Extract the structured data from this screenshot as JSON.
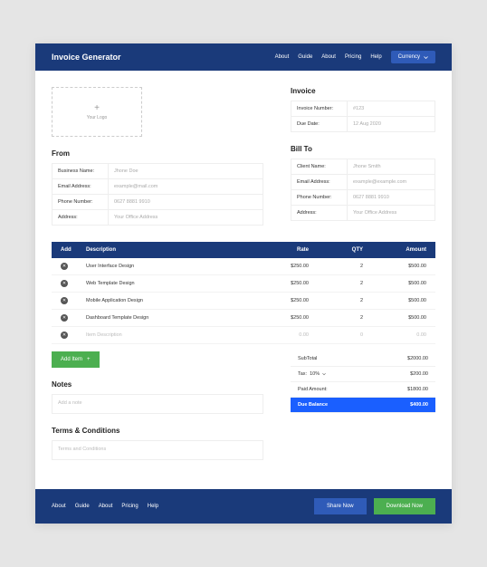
{
  "header": {
    "brand": "Invoice Generator",
    "nav": [
      "About",
      "Guide",
      "About",
      "Pricing",
      "Help"
    ],
    "currency_label": "Currency"
  },
  "logo": {
    "plus": "+",
    "text": "Your Logo"
  },
  "from": {
    "title": "From",
    "fields": [
      {
        "label": "Business Name:",
        "value": "Jhone Doe"
      },
      {
        "label": "Email Address:",
        "value": "example@mail.com"
      },
      {
        "label": "Phone Number:",
        "value": "0627 8881 9910"
      },
      {
        "label": "Address:",
        "value": "Your Office Address"
      }
    ]
  },
  "invoice": {
    "title": "Invoice",
    "fields": [
      {
        "label": "Invoice Number:",
        "value": "#123"
      },
      {
        "label": "Due Date:",
        "value": "12 Aug 2020"
      }
    ]
  },
  "billto": {
    "title": "Bill To",
    "fields": [
      {
        "label": "Client Name:",
        "value": "Jhone Smith"
      },
      {
        "label": "Email Address:",
        "value": "example@example.com"
      },
      {
        "label": "Phone Number:",
        "value": "0627 8881 9910"
      },
      {
        "label": "Address:",
        "value": "Your Office Address"
      }
    ]
  },
  "table": {
    "headers": {
      "add": "Add",
      "desc": "Description",
      "rate": "Rate",
      "qty": "QTY",
      "amount": "Amount"
    },
    "rows": [
      {
        "desc": "User Interface Design",
        "rate": "$250.00",
        "qty": "2",
        "amount": "$500.00"
      },
      {
        "desc": "Web Template Design",
        "rate": "$250.00",
        "qty": "2",
        "amount": "$500.00"
      },
      {
        "desc": "Mobile Application Design",
        "rate": "$250.00",
        "qty": "2",
        "amount": "$500.00"
      },
      {
        "desc": "Dashboard Template Design",
        "rate": "$250.00",
        "qty": "2",
        "amount": "$500.00"
      }
    ],
    "placeholder": {
      "desc": "Item Description",
      "rate": "0.00",
      "qty": "0",
      "amount": "0.00"
    }
  },
  "add_item_label": "Add Item",
  "notes": {
    "title": "Notes",
    "placeholder": "Add a note"
  },
  "terms": {
    "title": "Terms & Conditions",
    "placeholder": "Terms and Conditions"
  },
  "summary": {
    "subtotal_label": "SubTotal",
    "subtotal_value": "$2000.00",
    "tax_label": "Tax:",
    "tax_rate": "10%",
    "tax_value": "$200.00",
    "paid_label": "Paid Amount:",
    "paid_value": "$1800.00",
    "due_label": "Due Balance",
    "due_value": "$400.00"
  },
  "footer": {
    "nav": [
      "About",
      "Guide",
      "About",
      "Pricing",
      "Help"
    ],
    "share_label": "Share Now",
    "download_label": "Download Now"
  }
}
